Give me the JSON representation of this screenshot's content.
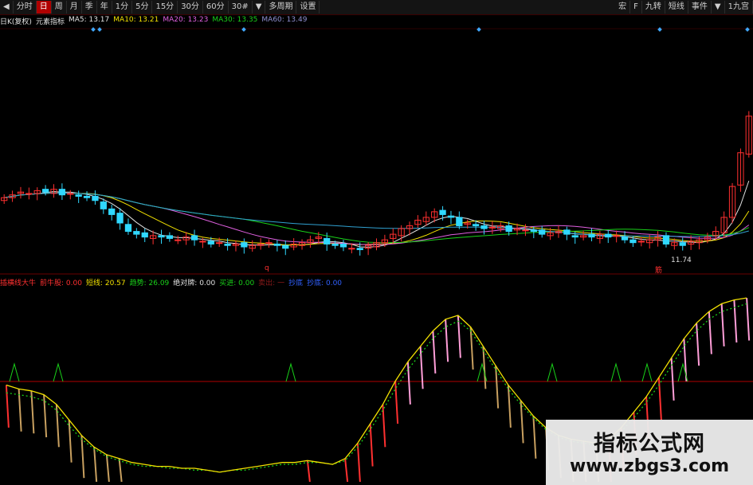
{
  "toolbar": {
    "left": [
      {
        "label": "◀",
        "name": "back-button"
      },
      {
        "label": "分时",
        "name": "tab-intraday"
      },
      {
        "label": "日",
        "name": "tab-day",
        "active": true
      },
      {
        "label": "周",
        "name": "tab-week"
      },
      {
        "label": "月",
        "name": "tab-month"
      },
      {
        "label": "季",
        "name": "tab-quarter"
      },
      {
        "label": "年",
        "name": "tab-year"
      },
      {
        "label": "1分",
        "name": "tab-1min"
      },
      {
        "label": "5分",
        "name": "tab-5min"
      },
      {
        "label": "15分",
        "name": "tab-15min"
      },
      {
        "label": "30分",
        "name": "tab-30min"
      },
      {
        "label": "60分",
        "name": "tab-60min"
      },
      {
        "label": "30#",
        "name": "tab-30sec"
      },
      {
        "label": "▼",
        "name": "period-dropdown"
      },
      {
        "label": "多周期",
        "name": "multi-period-button"
      },
      {
        "label": "设置",
        "name": "settings-button"
      }
    ],
    "right": [
      {
        "label": "宏",
        "name": "macro-button"
      },
      {
        "label": "F",
        "name": "f-button"
      },
      {
        "label": "九转",
        "name": "nine-turn-button"
      },
      {
        "label": "短线",
        "name": "short-term-button"
      },
      {
        "label": "事件",
        "name": "events-button"
      },
      {
        "label": "▼",
        "name": "events-dropdown"
      },
      {
        "label": "1九宫",
        "name": "grid-view-button"
      }
    ]
  },
  "ma_legend": [
    {
      "text": "日K(复权)",
      "color": "#e0e0e0"
    },
    {
      "text": "元素指标",
      "color": "#e0e0e0"
    },
    {
      "text": "MA5: 13.17",
      "color": "#e0e0e0"
    },
    {
      "text": "MA10: 13.21",
      "color": "#f2e100"
    },
    {
      "text": "MA20: 13.23",
      "color": "#e060e0"
    },
    {
      "text": "MA30: 13.35",
      "color": "#19d219"
    },
    {
      "text": "MA60: 13.49",
      "color": "#8f8fd0"
    }
  ],
  "ind_legend": [
    {
      "text": "插横线大牛",
      "color": "#ff3030"
    },
    {
      "text": "前牛股: 0.00",
      "color": "#ff3030"
    },
    {
      "text": "短线: 20.57",
      "color": "#f2e100"
    },
    {
      "text": "趋势: 26.09",
      "color": "#19d219"
    },
    {
      "text": "绝对牌: 0.00",
      "color": "#e0e0e0"
    },
    {
      "text": "买进: 0.00",
      "color": "#19d219"
    },
    {
      "text": "卖出: 一",
      "color": "#8b1a1a"
    },
    {
      "text": "抄底",
      "color": "#3060ff"
    },
    {
      "text": "抄底: 0.00",
      "color": "#3060ff"
    }
  ],
  "price_labels": {
    "low_label": "11.74",
    "marker_left": "q",
    "marker_right": "筋"
  },
  "watermark": {
    "title": "指标公式网",
    "url": "www.zbgs3.com"
  },
  "chart_data": {
    "type": "candlestick",
    "price_panel": {
      "ylim": [
        11.0,
        19.5
      ],
      "low": 11.74,
      "close": [
        13.6,
        13.7,
        13.8,
        13.75,
        13.85,
        13.8,
        13.9,
        13.7,
        13.75,
        13.65,
        13.6,
        13.5,
        13.2,
        13.0,
        12.7,
        12.4,
        12.3,
        12.2,
        12.25,
        12.2,
        12.15,
        12.1,
        12.2,
        12.1,
        12.05,
        11.95,
        12.0,
        11.9,
        11.95,
        11.85,
        11.9,
        11.95,
        12.0,
        11.9,
        11.8,
        11.95,
        12.0,
        12.1,
        12.2,
        11.95,
        11.9,
        11.85,
        11.8,
        11.75,
        11.9,
        12.0,
        12.1,
        12.3,
        12.5,
        12.6,
        12.8,
        12.9,
        13.1,
        13.0,
        12.9,
        12.6,
        12.7,
        12.6,
        12.5,
        12.55,
        12.6,
        12.4,
        12.5,
        12.45,
        12.4,
        12.3,
        12.35,
        12.4,
        12.3,
        12.2,
        12.25,
        12.2,
        12.3,
        12.2,
        12.25,
        12.1,
        12.0,
        12.05,
        12.1,
        12.2,
        11.95,
        12.0,
        11.9,
        12.05,
        12.1,
        12.2,
        12.4,
        12.9,
        14.0,
        15.2,
        16.5
      ]
    },
    "indicator_panel": {
      "ylim": [
        0,
        100
      ],
      "baseline": 45,
      "short_line": [
        50,
        48,
        47,
        45,
        40,
        32,
        24,
        18,
        14,
        12,
        10,
        9,
        8,
        8,
        7,
        7,
        6,
        5,
        6,
        7,
        8,
        9,
        10,
        10,
        11,
        10,
        9,
        12,
        20,
        30,
        40,
        52,
        62,
        70,
        78,
        84,
        86,
        80,
        70,
        60,
        50,
        42,
        34,
        28,
        24,
        22,
        21,
        20,
        22,
        28,
        36,
        44,
        54,
        64,
        74,
        82,
        88,
        92,
        94,
        95
      ],
      "trend_line": [
        46,
        45,
        44,
        42,
        37,
        29,
        22,
        17,
        13,
        11,
        9,
        8,
        8,
        7,
        7,
        6,
        6,
        5,
        6,
        6,
        7,
        8,
        9,
        9,
        10,
        10,
        9,
        11,
        18,
        27,
        37,
        48,
        58,
        66,
        74,
        80,
        83,
        78,
        68,
        58,
        48,
        40,
        33,
        27,
        23,
        21,
        20,
        19,
        21,
        26,
        33,
        41,
        50,
        60,
        70,
        78,
        84,
        88,
        90,
        92
      ]
    }
  }
}
